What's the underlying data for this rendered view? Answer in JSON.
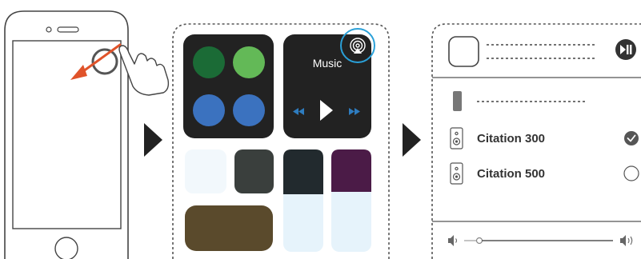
{
  "control_center": {
    "music_label": "Music"
  },
  "speaker_panel": {
    "speakers": [
      {
        "name": "Citation 300",
        "selected": true
      },
      {
        "name": "Citation 500",
        "selected": false
      }
    ]
  },
  "colors": {
    "tile_dark": "#222222",
    "green_dark": "#1b6b36",
    "green_light": "#63b957",
    "blue": "#3b72bf",
    "olive": "#5a4a2c",
    "slate": "#3a3f3d",
    "purple": "#4b1b47",
    "light_blue": "#e6f3fb",
    "highlight_circle": "#2aa0d8",
    "swipe_arrow": "#e0532a"
  }
}
